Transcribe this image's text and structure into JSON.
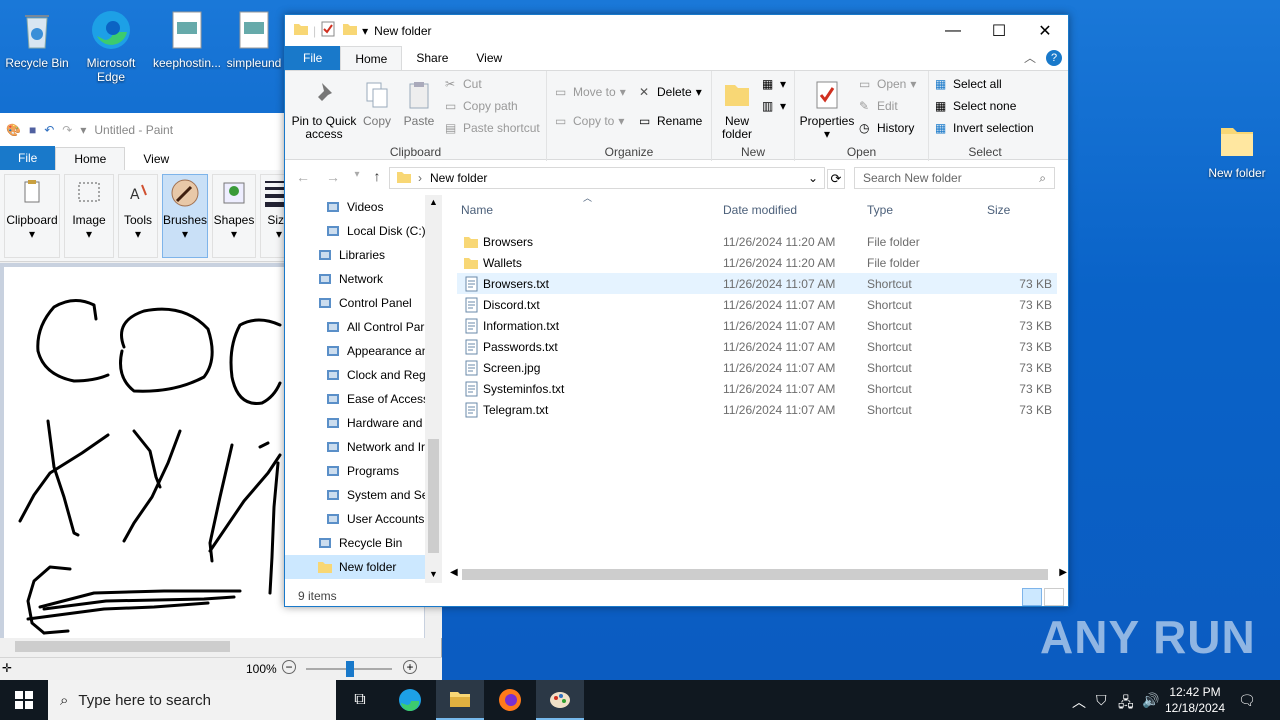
{
  "desktop": {
    "icons": [
      {
        "label": "Recycle Bin"
      },
      {
        "label": "Microsoft Edge"
      },
      {
        "label": "keephostin..."
      },
      {
        "label": "simpleund"
      },
      {
        "label": "New folder"
      }
    ]
  },
  "paint": {
    "title": "Untitled - Paint",
    "tabs": [
      "File",
      "Home",
      "View"
    ],
    "ribbon": [
      "Clipboard",
      "Image",
      "Tools",
      "Brushes",
      "Shapes",
      "Size"
    ],
    "zoom": "100%"
  },
  "explorer": {
    "title": "New folder",
    "tabs": [
      "File",
      "Home",
      "Share",
      "View"
    ],
    "clipboard": {
      "pin_label": "Pin to Quick access",
      "copy": "Copy",
      "paste": "Paste",
      "cut": "Cut",
      "copy_path": "Copy path",
      "paste_shortcut": "Paste shortcut",
      "group": "Clipboard"
    },
    "organize": {
      "move_to": "Move to",
      "copy_to": "Copy to",
      "delete": "Delete",
      "rename": "Rename",
      "group": "Organize"
    },
    "new": {
      "new_folder": "New folder",
      "group": "New"
    },
    "open": {
      "properties": "Properties",
      "open": "Open",
      "edit": "Edit",
      "history": "History",
      "group": "Open"
    },
    "select": {
      "select_all": "Select all",
      "select_none": "Select none",
      "invert": "Invert selection",
      "group": "Select"
    },
    "address": "New folder",
    "search_placeholder": "Search New folder",
    "nav": [
      {
        "label": "Videos",
        "indent": 2
      },
      {
        "label": "Local Disk (C:)",
        "indent": 2
      },
      {
        "label": "Libraries",
        "indent": 1
      },
      {
        "label": "Network",
        "indent": 1
      },
      {
        "label": "Control Panel",
        "indent": 1
      },
      {
        "label": "All Control Par",
        "indent": 2
      },
      {
        "label": "Appearance an",
        "indent": 2
      },
      {
        "label": "Clock and Regi",
        "indent": 2
      },
      {
        "label": "Ease of Access",
        "indent": 2
      },
      {
        "label": "Hardware and",
        "indent": 2
      },
      {
        "label": "Network and Ir",
        "indent": 2
      },
      {
        "label": "Programs",
        "indent": 2
      },
      {
        "label": "System and Se",
        "indent": 2
      },
      {
        "label": "User Accounts",
        "indent": 2
      },
      {
        "label": "Recycle Bin",
        "indent": 1
      },
      {
        "label": "New folder",
        "indent": 1
      }
    ],
    "columns": {
      "name": "Name",
      "date": "Date modified",
      "type": "Type",
      "size": "Size"
    },
    "files": [
      {
        "name": "Browsers",
        "date": "11/26/2024 11:20 AM",
        "type": "File folder",
        "size": "",
        "kind": "folder"
      },
      {
        "name": "Wallets",
        "date": "11/26/2024 11:20 AM",
        "type": "File folder",
        "size": "",
        "kind": "folder"
      },
      {
        "name": "Browsers.txt",
        "date": "11/26/2024 11:07 AM",
        "type": "Shortcut",
        "size": "73 KB",
        "kind": "shortcut"
      },
      {
        "name": "Discord.txt",
        "date": "11/26/2024 11:07 AM",
        "type": "Shortcut",
        "size": "73 KB",
        "kind": "shortcut"
      },
      {
        "name": "Information.txt",
        "date": "11/26/2024 11:07 AM",
        "type": "Shortcut",
        "size": "73 KB",
        "kind": "shortcut"
      },
      {
        "name": "Passwords.txt",
        "date": "11/26/2024 11:07 AM",
        "type": "Shortcut",
        "size": "73 KB",
        "kind": "shortcut"
      },
      {
        "name": "Screen.jpg",
        "date": "11/26/2024 11:07 AM",
        "type": "Shortcut",
        "size": "73 KB",
        "kind": "shortcut"
      },
      {
        "name": "Systeminfos.txt",
        "date": "11/26/2024 11:07 AM",
        "type": "Shortcut",
        "size": "73 KB",
        "kind": "shortcut"
      },
      {
        "name": "Telegram.txt",
        "date": "11/26/2024 11:07 AM",
        "type": "Shortcut",
        "size": "73 KB",
        "kind": "shortcut"
      }
    ],
    "status": "9 items"
  },
  "taskbar": {
    "search_placeholder": "Type here to search",
    "time": "12:42 PM",
    "date": "12/18/2024"
  },
  "watermark": "ANY RUN",
  "colors": {
    "accent": "#1979ca",
    "selection": "#cce8ff",
    "folder": "#f8d775"
  }
}
